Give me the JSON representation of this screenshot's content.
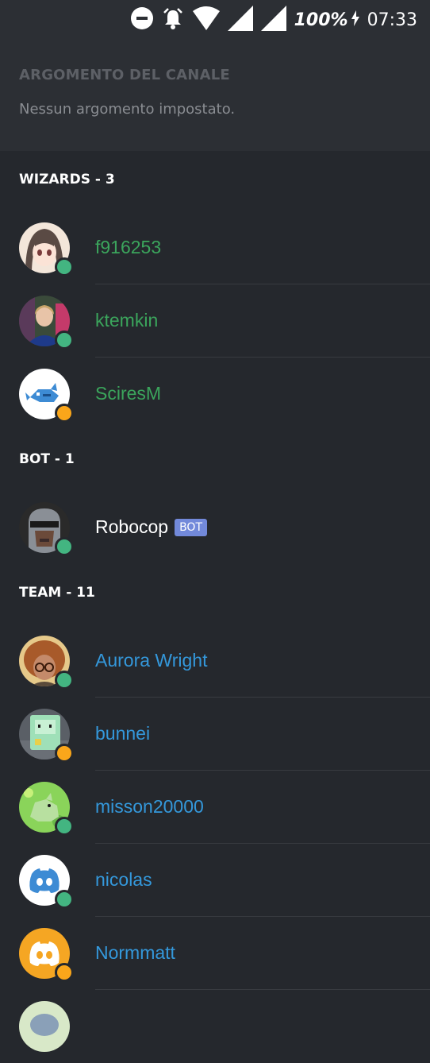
{
  "status_bar": {
    "battery": "100%",
    "time": "07:33"
  },
  "topic": {
    "title": "ARGOMENTO DEL CANALE",
    "text": "Nessun argomento impostato."
  },
  "colors": {
    "wizard": "#3ba55c",
    "team": "#3498db",
    "bot": "#ffffff",
    "online": "#43b581",
    "idle": "#faa61a",
    "bot_badge": "#7289da"
  },
  "sections": {
    "wizards": {
      "header": "WIZARDS - 3",
      "members": [
        {
          "name": "f916253",
          "status": "online"
        },
        {
          "name": "ktemkin",
          "status": "online"
        },
        {
          "name": "SciresM",
          "status": "idle"
        }
      ]
    },
    "bot": {
      "header": "BOT - 1",
      "members": [
        {
          "name": "Robocop",
          "badge": "BOT",
          "status": "online"
        }
      ]
    },
    "team": {
      "header": "TEAM - 11",
      "members": [
        {
          "name": "Aurora Wright",
          "status": "online"
        },
        {
          "name": "bunnei",
          "status": "idle"
        },
        {
          "name": "misson20000",
          "status": "online"
        },
        {
          "name": "nicolas",
          "status": "online"
        },
        {
          "name": "Normmatt",
          "status": "idle"
        }
      ]
    }
  }
}
